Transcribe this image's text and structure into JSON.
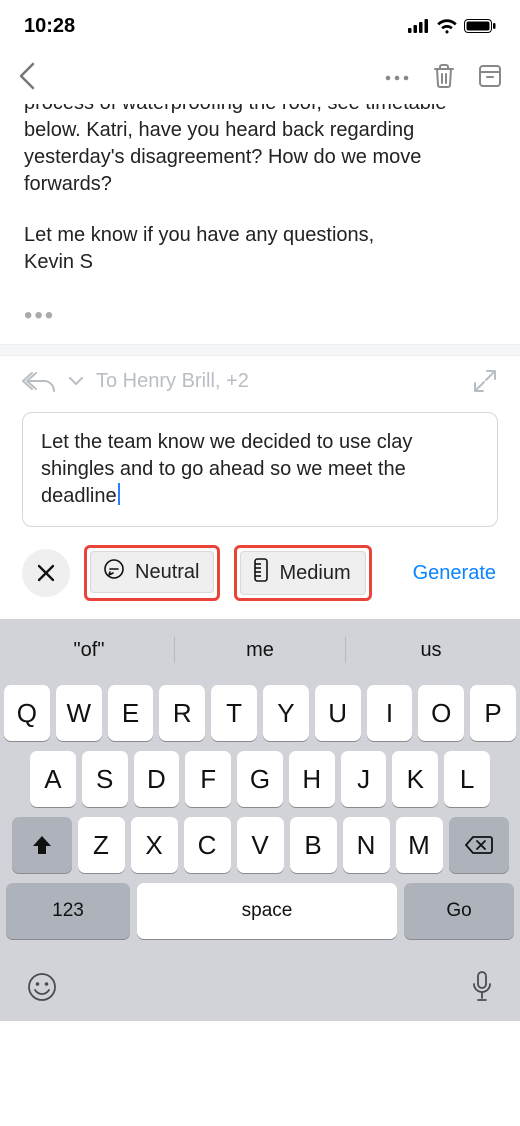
{
  "status": {
    "time": "10:28"
  },
  "mail": {
    "clipped_line": "process of waterproofing the roof, see timetable",
    "para1": "below. Katri, have you heard back regarding yesterday's disagreement? How do we move forwards?",
    "para2": "Let me know if you have any questions,",
    "signoff": "Kevin S"
  },
  "reply": {
    "to": "To Henry Brill, +2"
  },
  "compose": {
    "text": "Let the team know we decided to use clay shingles and to go ahead so we meet the deadline"
  },
  "options": {
    "tone_label": "Neutral",
    "length_label": "Medium",
    "generate_label": "Generate"
  },
  "keyboard": {
    "sugg1": "\"of\"",
    "sugg2": "me",
    "sugg3": "us",
    "row1": [
      "Q",
      "W",
      "E",
      "R",
      "T",
      "Y",
      "U",
      "I",
      "O",
      "P"
    ],
    "row2": [
      "A",
      "S",
      "D",
      "F",
      "G",
      "H",
      "J",
      "K",
      "L"
    ],
    "row3": [
      "Z",
      "X",
      "C",
      "V",
      "B",
      "N",
      "M"
    ],
    "num_label": "123",
    "space_label": "space",
    "go_label": "Go"
  }
}
